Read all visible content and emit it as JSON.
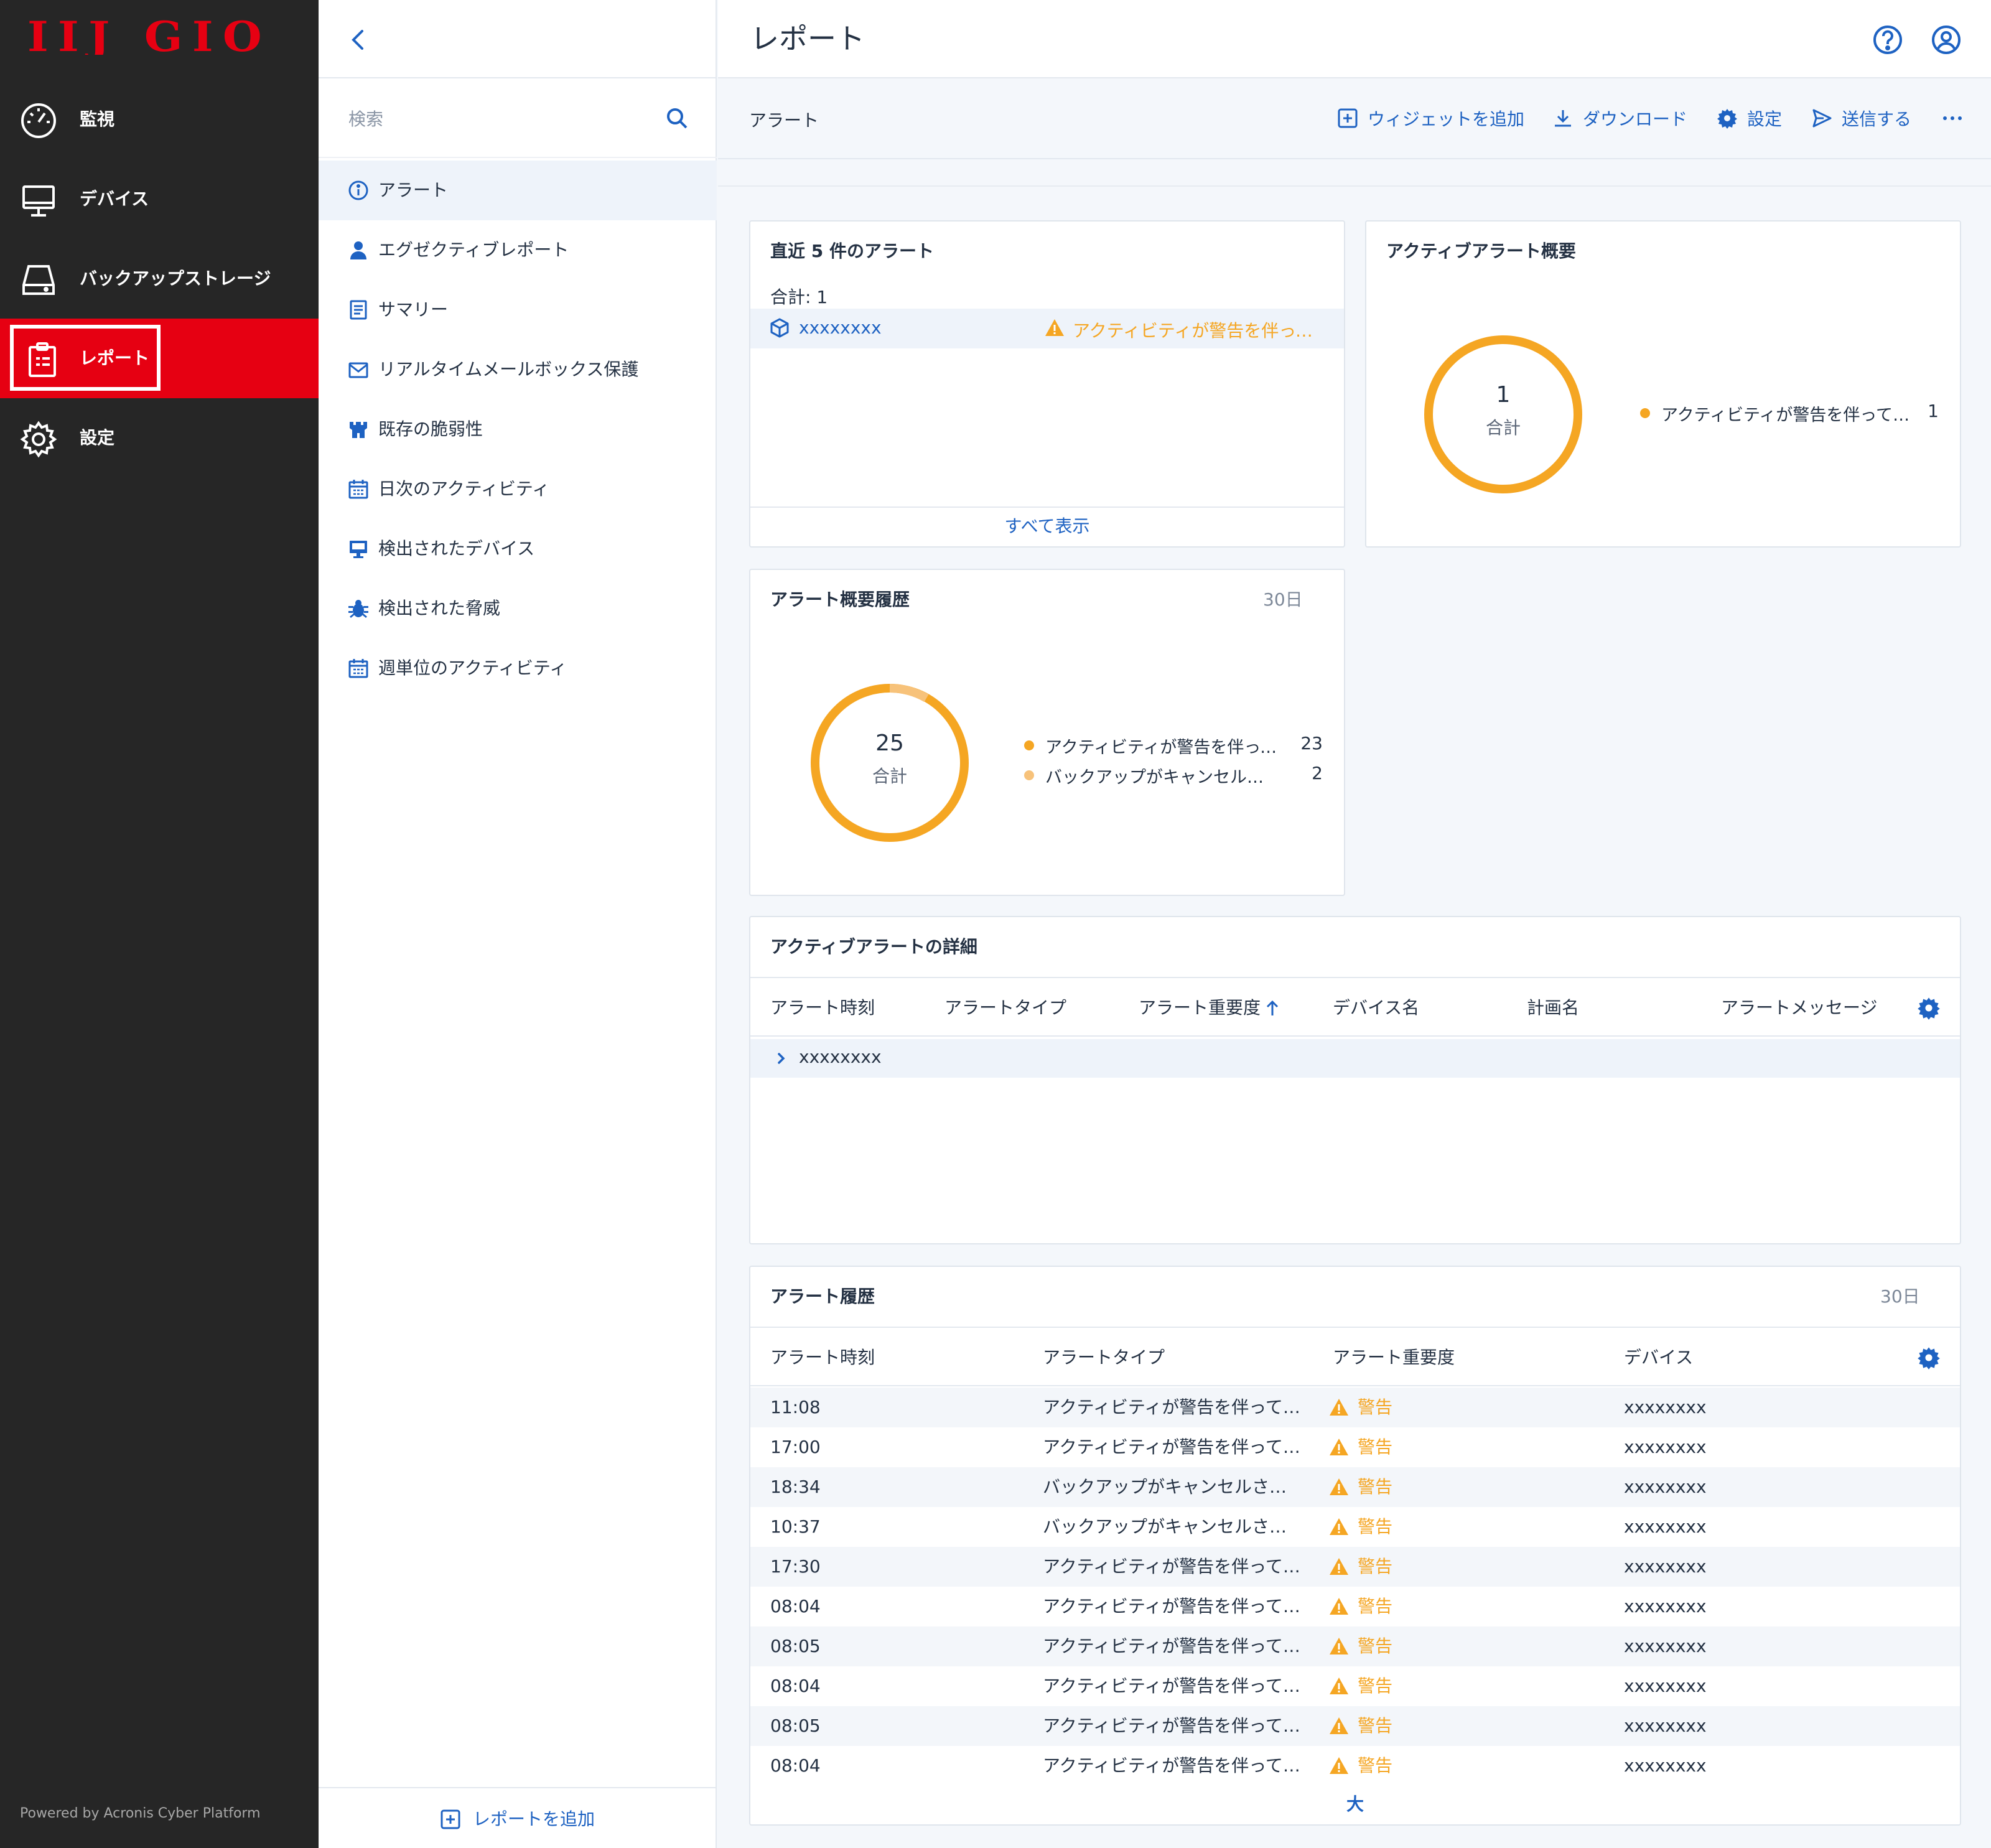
{
  "brand": {
    "logo_text": "IIJ GIO",
    "logo_color": "#e60012",
    "accent_color": "#1e62c2",
    "warning_color": "#f5a623"
  },
  "nav": {
    "items": [
      {
        "label": "監視",
        "icon": "gauge-icon"
      },
      {
        "label": "デバイス",
        "icon": "monitor-icon"
      },
      {
        "label": "バックアップストレージ",
        "icon": "drive-icon"
      },
      {
        "label": "レポート",
        "icon": "clipboard-icon",
        "active": true
      },
      {
        "label": "設定",
        "icon": "gear-icon"
      }
    ],
    "powered_by": "Powered by Acronis Cyber Platform"
  },
  "reports_panel": {
    "search_placeholder": "検索",
    "items": [
      {
        "label": "アラート",
        "icon": "info-icon",
        "active": true
      },
      {
        "label": "エグゼクティブレポート",
        "icon": "person-icon"
      },
      {
        "label": "サマリー",
        "icon": "document-icon"
      },
      {
        "label": "リアルタイムメールボックス保護",
        "icon": "mail-icon"
      },
      {
        "label": "既存の脆弱性",
        "icon": "castle-icon"
      },
      {
        "label": "日次のアクティビティ",
        "icon": "calendar-icon"
      },
      {
        "label": "検出されたデバイス",
        "icon": "monitor-icon"
      },
      {
        "label": "検出された脅威",
        "icon": "bug-icon"
      },
      {
        "label": "週単位のアクティビティ",
        "icon": "calendar-icon"
      }
    ],
    "add_report_label": "レポートを追加"
  },
  "header": {
    "title": "レポート",
    "help_icon": "help-icon",
    "account_icon": "account-icon"
  },
  "toolbar": {
    "breadcrumb": "アラート",
    "add_widget": "ウィジェットを追加",
    "download": "ダウンロード",
    "settings": "設定",
    "send": "送信する",
    "more_icon": "more-icon"
  },
  "widgets": {
    "recent_alerts": {
      "title": "直近 5 件のアラート",
      "total": "合計: 1",
      "rows": [
        {
          "device": "xxxxxxxx",
          "message": "アクティビティが警告を伴って完了しました"
        }
      ],
      "show_all": "すべて表示"
    },
    "active_summary": {
      "title": "アクティブアラート概要",
      "total_value": "1",
      "total_label": "合計",
      "legend": [
        {
          "label": "アクティビティが警告を伴って完了しました",
          "value": "1",
          "color": "#f5a623"
        }
      ]
    },
    "history_summary": {
      "title": "アラート概要履歴",
      "period": "30日",
      "total_value": "25",
      "total_label": "合計",
      "legend": [
        {
          "label": "アクティビティが警告を伴って完了しました",
          "value": "23",
          "color": "#f5a623"
        },
        {
          "label": "バックアップがキャンセルされました",
          "value": "2",
          "color": "#f7c27a"
        }
      ]
    },
    "active_details": {
      "title": "アクティブアラートの詳細",
      "columns": [
        "アラート時刻",
        "アラートタイプ",
        "アラート重要度",
        "デバイス名",
        "計画名",
        "アラートメッセージ"
      ],
      "rows": [
        {
          "device": "xxxxxxxx"
        }
      ]
    },
    "alert_history": {
      "title": "アラート履歴",
      "period": "30日",
      "columns": [
        "アラート時刻",
        "アラートタイプ",
        "アラート重要度",
        "デバイス"
      ],
      "rows": [
        {
          "time": "11:08",
          "type": "アクティビティが警告を伴って完了しました",
          "severity": "警告",
          "device": "xxxxxxxx"
        },
        {
          "time": "17:00",
          "type": "アクティビティが警告を伴って完了しました",
          "severity": "警告",
          "device": "xxxxxxxx"
        },
        {
          "time": "18:34",
          "type": "バックアップがキャンセルされました",
          "severity": "警告",
          "device": "xxxxxxxx"
        },
        {
          "time": "10:37",
          "type": "バックアップがキャンセルされました",
          "severity": "警告",
          "device": "xxxxxxxx"
        },
        {
          "time": "17:30",
          "type": "アクティビティが警告を伴って完了しました",
          "severity": "警告",
          "device": "xxxxxxxx"
        },
        {
          "time": "08:04",
          "type": "アクティビティが警告を伴って完了しました",
          "severity": "警告",
          "device": "xxxxxxxx"
        },
        {
          "time": "08:05",
          "type": "アクティビティが警告を伴って完了しました",
          "severity": "警告",
          "device": "xxxxxxxx"
        },
        {
          "time": "08:04",
          "type": "アクティビティが警告を伴って完了しました",
          "severity": "警告",
          "device": "xxxxxxxx"
        },
        {
          "time": "08:05",
          "type": "アクティビティが警告を伴って完了しました",
          "severity": "警告",
          "device": "xxxxxxxx"
        },
        {
          "time": "08:04",
          "type": "アクティビティが警告を伴って完了しました",
          "severity": "警告",
          "device": "xxxxxxxx"
        }
      ],
      "footer": "大"
    }
  }
}
